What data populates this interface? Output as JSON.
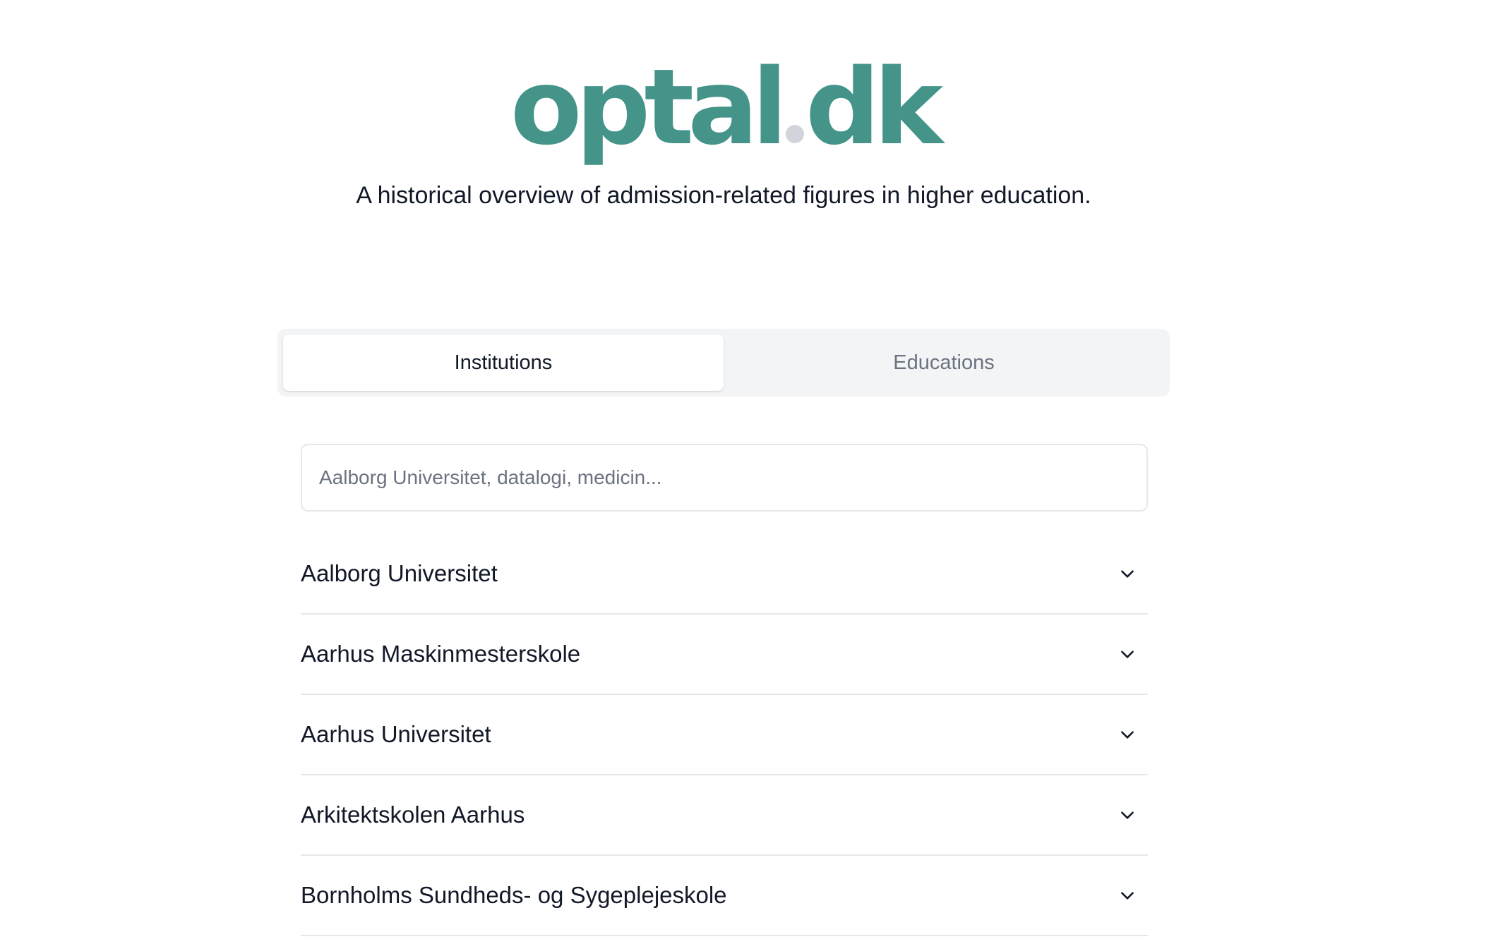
{
  "header": {
    "logo_left": "optal",
    "logo_right": "dk",
    "tagline": "A historical overview of admission-related figures in higher education."
  },
  "tabs": [
    {
      "label": "Institutions",
      "active": true
    },
    {
      "label": "Educations",
      "active": false
    }
  ],
  "search": {
    "placeholder": "Aalborg Universitet, datalogi, medicin...",
    "value": ""
  },
  "institutions": [
    {
      "label": "Aalborg Universitet",
      "icon": "chevron-down-icon"
    },
    {
      "label": "Aarhus Maskinmesterskole",
      "icon": "chevron-down-icon"
    },
    {
      "label": "Aarhus Universitet",
      "icon": "chevron-down-icon"
    },
    {
      "label": "Arkitektskolen Aarhus",
      "icon": "chevron-down-icon"
    },
    {
      "label": "Bornholms Sundheds- og Sygeplejeskole",
      "icon": "chevron-down-icon"
    }
  ],
  "colors": {
    "brand": "#44948a",
    "logo_dot": "#d1d5db",
    "tab_bg": "#f3f4f6",
    "border": "#e5e7eb",
    "muted_text": "#6b7280",
    "text": "#111827"
  }
}
